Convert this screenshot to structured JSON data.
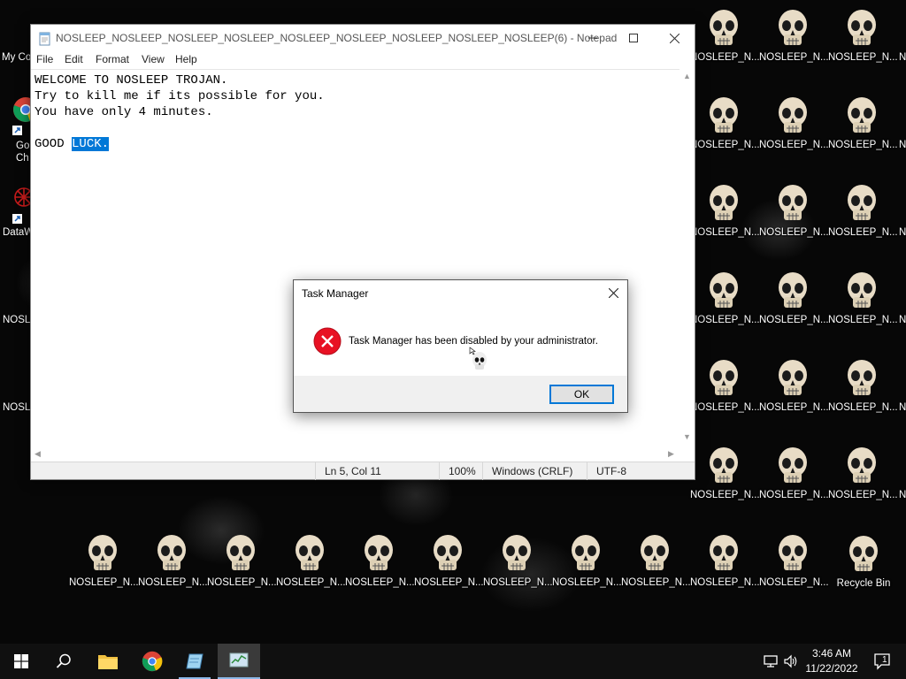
{
  "desktop": {
    "icon_label": "NOSLEEP_N...",
    "recycle_bin_label": "Recycle Bin",
    "left_labels": [
      "My Co",
      "Go",
      "Ch",
      "DataW",
      "NOSL",
      "NOSL"
    ],
    "right_labels": [
      "N",
      "N",
      "N",
      "N",
      "N",
      "N"
    ]
  },
  "notepad": {
    "title": "NOSLEEP_NOSLEEP_NOSLEEP_NOSLEEP_NOSLEEP_NOSLEEP_NOSLEEP_NOSLEEP_NOSLEEP(6) - Notepad",
    "menu": [
      "File",
      "Edit",
      "Format",
      "View",
      "Help"
    ],
    "lines": [
      "WELCOME TO NOSLEEP TROJAN.",
      "Try to kill me if its possible for you.",
      "You have only 4 minutes.",
      ""
    ],
    "last_line_plain": "GOOD ",
    "last_line_selected": "LUCK.",
    "status": {
      "position": "Ln 5, Col 11",
      "zoom": "100%",
      "line_ending": "Windows (CRLF)",
      "encoding": "UTF-8"
    }
  },
  "dialog": {
    "title": "Task Manager",
    "message": "Task Manager has been disabled by your administrator.",
    "ok_label": "OK"
  },
  "taskbar": {
    "time": "3:46 AM",
    "date": "11/22/2022",
    "notification_count": "1"
  }
}
